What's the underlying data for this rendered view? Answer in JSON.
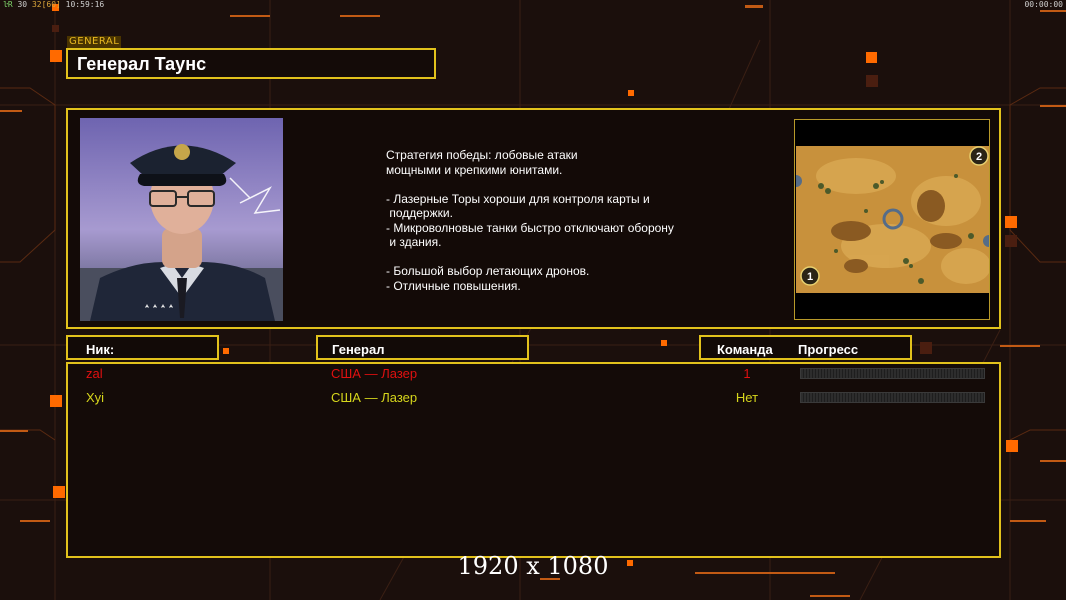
{
  "hud": {
    "top_left_a": "ŀR",
    "top_left_b": "30",
    "top_left_c": "32",
    "top_left_d": "[60]",
    "top_left_time": "10:59:16",
    "top_right_time": "00:00:00"
  },
  "general_tag": "GENERAL",
  "general_name": "Генерал Таунс",
  "description": "Стратегия победы: лобовые атаки\nмощными и крепкими юнитами.\n\n- Лазерные Торы хороши для контроля карты и\n поддержки.\n- Микроволновые танки быстро отключают оборону\n и здания.\n\n- Большой выбор летающих дронов.\n- Отличные повышения.",
  "map": {
    "start_positions": [
      "1",
      "2"
    ]
  },
  "headers": {
    "nick": "Ник:",
    "general": "Генерал",
    "team": "Команда",
    "progress": "Прогресс"
  },
  "players": [
    {
      "nick": "zal",
      "general": "США — Лазер",
      "team": "1",
      "progress": 0,
      "color": "#e01010"
    },
    {
      "nick": "Xyi",
      "general": "США — Лазер",
      "team": "Нет",
      "progress": 0,
      "color": "#d6d61c"
    }
  ],
  "resolution_label": "1920 x 1080",
  "colors": {
    "frame": "#e2c21c",
    "accent_orange": "#ff6a00",
    "background": "#1b0f0c"
  }
}
